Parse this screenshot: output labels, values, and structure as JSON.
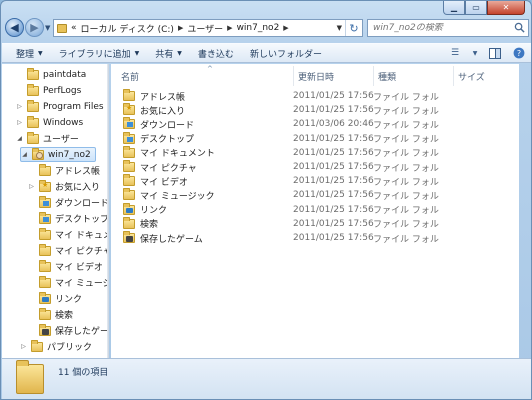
{
  "window": {
    "caption": {
      "minimize": "▁",
      "maximize": "▭",
      "close": "✕"
    }
  },
  "address": {
    "prefix": "«",
    "crumbs": [
      "ローカル ディスク (C:)",
      "ユーザー",
      "win7_no2"
    ]
  },
  "search": {
    "placeholder": "win7_no2の検索"
  },
  "toolbar": {
    "items": [
      {
        "label": "整理",
        "dropdown": true
      },
      {
        "label": "ライブラリに追加",
        "dropdown": true
      },
      {
        "label": "共有",
        "dropdown": true
      },
      {
        "label": "書き込む",
        "dropdown": false
      },
      {
        "label": "新しいフォルダー",
        "dropdown": false
      }
    ]
  },
  "tree": [
    {
      "label": "paintdata",
      "expander": "",
      "icon": "folder",
      "indent": 0
    },
    {
      "label": "PerfLogs",
      "expander": "",
      "icon": "folder",
      "indent": 0
    },
    {
      "label": "Program Files",
      "expander": "▷",
      "icon": "folder",
      "indent": 0
    },
    {
      "label": "Windows",
      "expander": "▷",
      "icon": "folder",
      "indent": 0
    },
    {
      "label": "ユーザー",
      "expander": "◢",
      "icon": "folder",
      "indent": 0
    },
    {
      "label": "win7_no2",
      "expander": "◢",
      "icon": "user",
      "indent": 1,
      "selected": true
    },
    {
      "label": "アドレス帳",
      "expander": "",
      "icon": "folder",
      "indent": 2
    },
    {
      "label": "お気に入り",
      "expander": "▷",
      "icon": "star",
      "indent": 2
    },
    {
      "label": "ダウンロード",
      "expander": "",
      "icon": "blue",
      "indent": 2
    },
    {
      "label": "デスクトップ",
      "expander": "",
      "icon": "blue",
      "indent": 2
    },
    {
      "label": "マイ ドキュメント",
      "expander": "",
      "icon": "folder",
      "indent": 2
    },
    {
      "label": "マイ ピクチャ",
      "expander": "",
      "icon": "folder",
      "indent": 2
    },
    {
      "label": "マイ ビデオ",
      "expander": "",
      "icon": "folder",
      "indent": 2
    },
    {
      "label": "マイ ミュージック",
      "expander": "",
      "icon": "folder",
      "indent": 2
    },
    {
      "label": "リンク",
      "expander": "",
      "icon": "link",
      "indent": 2
    },
    {
      "label": "検索",
      "expander": "",
      "icon": "folder",
      "indent": 2
    },
    {
      "label": "保存したゲーム",
      "expander": "",
      "icon": "game",
      "indent": 2
    },
    {
      "label": "パブリック",
      "expander": "▷",
      "icon": "folder",
      "indent": 1
    }
  ],
  "columns": [
    "名前",
    "更新日時",
    "種類",
    "サイズ"
  ],
  "files": [
    {
      "name": "アドレス帳",
      "date": "2011/01/25 17:56",
      "type": "ファイル フォル...",
      "icon": "folder"
    },
    {
      "name": "お気に入り",
      "date": "2011/01/25 17:56",
      "type": "ファイル フォル...",
      "icon": "star"
    },
    {
      "name": "ダウンロード",
      "date": "2011/03/06 20:46",
      "type": "ファイル フォル...",
      "icon": "blue"
    },
    {
      "name": "デスクトップ",
      "date": "2011/01/25 17:56",
      "type": "ファイル フォル...",
      "icon": "blue"
    },
    {
      "name": "マイ ドキュメント",
      "date": "2011/01/25 17:56",
      "type": "ファイル フォル...",
      "icon": "folder"
    },
    {
      "name": "マイ ピクチャ",
      "date": "2011/01/25 17:56",
      "type": "ファイル フォル...",
      "icon": "folder"
    },
    {
      "name": "マイ ビデオ",
      "date": "2011/01/25 17:56",
      "type": "ファイル フォル...",
      "icon": "folder"
    },
    {
      "name": "マイ ミュージック",
      "date": "2011/01/25 17:56",
      "type": "ファイル フォル...",
      "icon": "folder"
    },
    {
      "name": "リンク",
      "date": "2011/01/25 17:56",
      "type": "ファイル フォル...",
      "icon": "link"
    },
    {
      "name": "検索",
      "date": "2011/01/25 17:56",
      "type": "ファイル フォル...",
      "icon": "folder"
    },
    {
      "name": "保存したゲーム",
      "date": "2011/01/25 17:56",
      "type": "ファイル フォル...",
      "icon": "game"
    }
  ],
  "details": {
    "count_text": "11 個の項目"
  }
}
